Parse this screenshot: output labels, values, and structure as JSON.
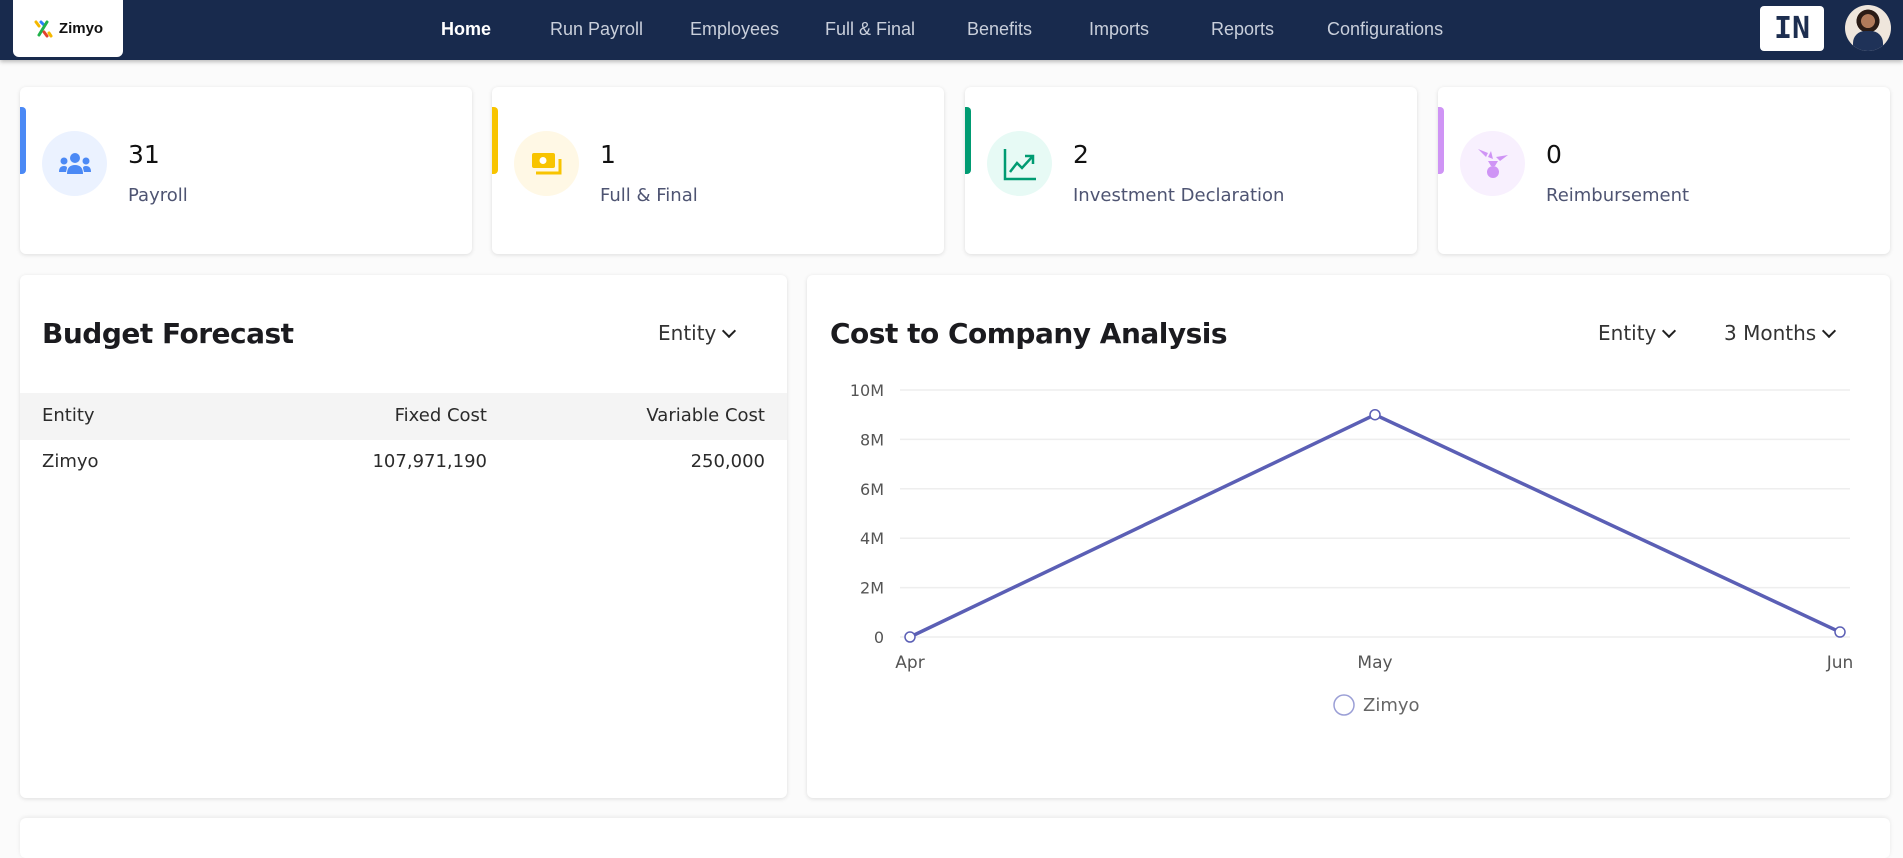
{
  "brand": {
    "name": "Zimyo"
  },
  "nav": {
    "items": [
      {
        "label": "Home",
        "active": true
      },
      {
        "label": "Run Payroll",
        "active": false
      },
      {
        "label": "Employees",
        "active": false
      },
      {
        "label": "Full & Final",
        "active": false
      },
      {
        "label": "Benefits",
        "active": false
      },
      {
        "label": "Imports",
        "active": false
      },
      {
        "label": "Reports",
        "active": false
      },
      {
        "label": "Configurations",
        "active": false
      }
    ],
    "language": "IN",
    "avatar_icon": "user-avatar"
  },
  "summary_cards": [
    {
      "count": "31",
      "label": "Payroll",
      "icon": "users-icon",
      "accent": "#4b89f5",
      "icon_bg": "#ebf2ff"
    },
    {
      "count": "1",
      "label": "Full & Final",
      "icon": "money-icon",
      "accent": "#f8c400",
      "icon_bg": "#fff8e5"
    },
    {
      "count": "2",
      "label": "Investment Declaration",
      "icon": "trend-up-icon",
      "accent": "#009b72",
      "icon_bg": "#e7faf5"
    },
    {
      "count": "0",
      "label": "Reimbursement",
      "icon": "plant-icon",
      "accent": "#cf94f5",
      "icon_bg": "#f8f0fe"
    }
  ],
  "budget_forecast": {
    "title": "Budget Forecast",
    "filter": "Entity",
    "columns": [
      "Entity",
      "Fixed Cost",
      "Variable Cost"
    ],
    "rows": [
      {
        "entity": "Zimyo",
        "fixed_cost": "107,971,190",
        "variable_cost": "250,000"
      }
    ]
  },
  "ctc_analysis": {
    "title": "Cost to Company Analysis",
    "filters": {
      "entity": "Entity",
      "period": "3 Months"
    }
  },
  "chart_data": {
    "type": "line",
    "title": "Cost to Company Analysis",
    "xlabel": "",
    "ylabel": "",
    "categories": [
      "Apr",
      "May",
      "Jun"
    ],
    "series": [
      {
        "name": "Zimyo",
        "values": [
          0,
          9000000,
          200000
        ],
        "color": "#5b5fb5"
      }
    ],
    "ylim": [
      0,
      10000000
    ],
    "yticks": [
      0,
      2000000,
      4000000,
      6000000,
      8000000,
      10000000
    ],
    "ytick_labels": [
      "0",
      "2M",
      "4M",
      "6M",
      "8M",
      "10M"
    ],
    "grid": true,
    "legend": "bottom-center"
  }
}
